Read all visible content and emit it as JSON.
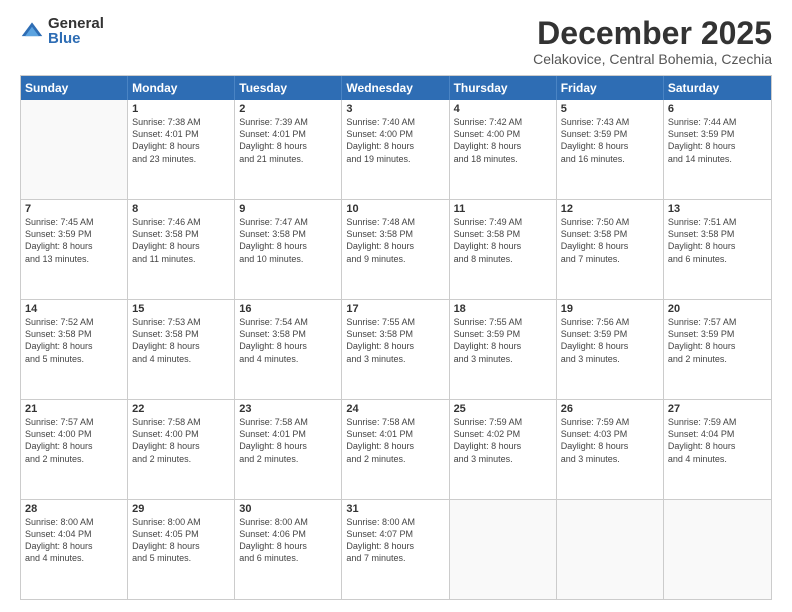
{
  "logo": {
    "general": "General",
    "blue": "Blue"
  },
  "header": {
    "month": "December 2025",
    "location": "Celakovice, Central Bohemia, Czechia"
  },
  "days": [
    "Sunday",
    "Monday",
    "Tuesday",
    "Wednesday",
    "Thursday",
    "Friday",
    "Saturday"
  ],
  "rows": [
    [
      {
        "day": "",
        "lines": []
      },
      {
        "day": "1",
        "lines": [
          "Sunrise: 7:38 AM",
          "Sunset: 4:01 PM",
          "Daylight: 8 hours",
          "and 23 minutes."
        ]
      },
      {
        "day": "2",
        "lines": [
          "Sunrise: 7:39 AM",
          "Sunset: 4:01 PM",
          "Daylight: 8 hours",
          "and 21 minutes."
        ]
      },
      {
        "day": "3",
        "lines": [
          "Sunrise: 7:40 AM",
          "Sunset: 4:00 PM",
          "Daylight: 8 hours",
          "and 19 minutes."
        ]
      },
      {
        "day": "4",
        "lines": [
          "Sunrise: 7:42 AM",
          "Sunset: 4:00 PM",
          "Daylight: 8 hours",
          "and 18 minutes."
        ]
      },
      {
        "day": "5",
        "lines": [
          "Sunrise: 7:43 AM",
          "Sunset: 3:59 PM",
          "Daylight: 8 hours",
          "and 16 minutes."
        ]
      },
      {
        "day": "6",
        "lines": [
          "Sunrise: 7:44 AM",
          "Sunset: 3:59 PM",
          "Daylight: 8 hours",
          "and 14 minutes."
        ]
      }
    ],
    [
      {
        "day": "7",
        "lines": [
          "Sunrise: 7:45 AM",
          "Sunset: 3:59 PM",
          "Daylight: 8 hours",
          "and 13 minutes."
        ]
      },
      {
        "day": "8",
        "lines": [
          "Sunrise: 7:46 AM",
          "Sunset: 3:58 PM",
          "Daylight: 8 hours",
          "and 11 minutes."
        ]
      },
      {
        "day": "9",
        "lines": [
          "Sunrise: 7:47 AM",
          "Sunset: 3:58 PM",
          "Daylight: 8 hours",
          "and 10 minutes."
        ]
      },
      {
        "day": "10",
        "lines": [
          "Sunrise: 7:48 AM",
          "Sunset: 3:58 PM",
          "Daylight: 8 hours",
          "and 9 minutes."
        ]
      },
      {
        "day": "11",
        "lines": [
          "Sunrise: 7:49 AM",
          "Sunset: 3:58 PM",
          "Daylight: 8 hours",
          "and 8 minutes."
        ]
      },
      {
        "day": "12",
        "lines": [
          "Sunrise: 7:50 AM",
          "Sunset: 3:58 PM",
          "Daylight: 8 hours",
          "and 7 minutes."
        ]
      },
      {
        "day": "13",
        "lines": [
          "Sunrise: 7:51 AM",
          "Sunset: 3:58 PM",
          "Daylight: 8 hours",
          "and 6 minutes."
        ]
      }
    ],
    [
      {
        "day": "14",
        "lines": [
          "Sunrise: 7:52 AM",
          "Sunset: 3:58 PM",
          "Daylight: 8 hours",
          "and 5 minutes."
        ]
      },
      {
        "day": "15",
        "lines": [
          "Sunrise: 7:53 AM",
          "Sunset: 3:58 PM",
          "Daylight: 8 hours",
          "and 4 minutes."
        ]
      },
      {
        "day": "16",
        "lines": [
          "Sunrise: 7:54 AM",
          "Sunset: 3:58 PM",
          "Daylight: 8 hours",
          "and 4 minutes."
        ]
      },
      {
        "day": "17",
        "lines": [
          "Sunrise: 7:55 AM",
          "Sunset: 3:58 PM",
          "Daylight: 8 hours",
          "and 3 minutes."
        ]
      },
      {
        "day": "18",
        "lines": [
          "Sunrise: 7:55 AM",
          "Sunset: 3:59 PM",
          "Daylight: 8 hours",
          "and 3 minutes."
        ]
      },
      {
        "day": "19",
        "lines": [
          "Sunrise: 7:56 AM",
          "Sunset: 3:59 PM",
          "Daylight: 8 hours",
          "and 3 minutes."
        ]
      },
      {
        "day": "20",
        "lines": [
          "Sunrise: 7:57 AM",
          "Sunset: 3:59 PM",
          "Daylight: 8 hours",
          "and 2 minutes."
        ]
      }
    ],
    [
      {
        "day": "21",
        "lines": [
          "Sunrise: 7:57 AM",
          "Sunset: 4:00 PM",
          "Daylight: 8 hours",
          "and 2 minutes."
        ]
      },
      {
        "day": "22",
        "lines": [
          "Sunrise: 7:58 AM",
          "Sunset: 4:00 PM",
          "Daylight: 8 hours",
          "and 2 minutes."
        ]
      },
      {
        "day": "23",
        "lines": [
          "Sunrise: 7:58 AM",
          "Sunset: 4:01 PM",
          "Daylight: 8 hours",
          "and 2 minutes."
        ]
      },
      {
        "day": "24",
        "lines": [
          "Sunrise: 7:58 AM",
          "Sunset: 4:01 PM",
          "Daylight: 8 hours",
          "and 2 minutes."
        ]
      },
      {
        "day": "25",
        "lines": [
          "Sunrise: 7:59 AM",
          "Sunset: 4:02 PM",
          "Daylight: 8 hours",
          "and 3 minutes."
        ]
      },
      {
        "day": "26",
        "lines": [
          "Sunrise: 7:59 AM",
          "Sunset: 4:03 PM",
          "Daylight: 8 hours",
          "and 3 minutes."
        ]
      },
      {
        "day": "27",
        "lines": [
          "Sunrise: 7:59 AM",
          "Sunset: 4:04 PM",
          "Daylight: 8 hours",
          "and 4 minutes."
        ]
      }
    ],
    [
      {
        "day": "28",
        "lines": [
          "Sunrise: 8:00 AM",
          "Sunset: 4:04 PM",
          "Daylight: 8 hours",
          "and 4 minutes."
        ]
      },
      {
        "day": "29",
        "lines": [
          "Sunrise: 8:00 AM",
          "Sunset: 4:05 PM",
          "Daylight: 8 hours",
          "and 5 minutes."
        ]
      },
      {
        "day": "30",
        "lines": [
          "Sunrise: 8:00 AM",
          "Sunset: 4:06 PM",
          "Daylight: 8 hours",
          "and 6 minutes."
        ]
      },
      {
        "day": "31",
        "lines": [
          "Sunrise: 8:00 AM",
          "Sunset: 4:07 PM",
          "Daylight: 8 hours",
          "and 7 minutes."
        ]
      },
      {
        "day": "",
        "lines": []
      },
      {
        "day": "",
        "lines": []
      },
      {
        "day": "",
        "lines": []
      }
    ]
  ]
}
